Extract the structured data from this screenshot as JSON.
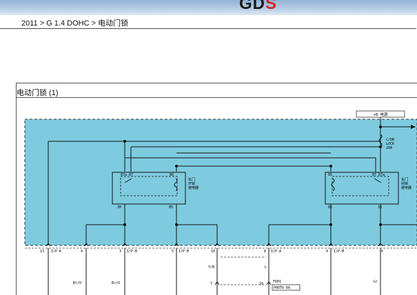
{
  "header": {
    "logo_main": "GD",
    "logo_accent": "S"
  },
  "breadcrumb": {
    "text": "2011 > G 1.4 DOHC > 电动门锁"
  },
  "document": {
    "title": "电动门锁 (1)"
  },
  "diagram": {
    "power_label": "+B 电源",
    "fuse_label": "C/DR\nLOCK\n20A",
    "relays": [
      {
        "name": "车门\n开锁\n继电器",
        "pins_top": [
          "87a",
          "87",
          "86"
        ],
        "pins_bottom": [
          "30",
          "85"
        ]
      },
      {
        "name": "车门\n闭锁\n继电器",
        "pins_top": [
          "85",
          "87",
          "87a"
        ],
        "pins_bottom": [
          "86",
          "30"
        ]
      }
    ],
    "connectors": [
      {
        "pin": "13",
        "label": "I/P-K"
      },
      {
        "pin": "4",
        "label": ""
      },
      {
        "pin": "3",
        "label": "I/P-B"
      },
      {
        "pin": "5",
        "label": "I/P-M"
      },
      {
        "pin": "10",
        "label": ""
      },
      {
        "pin": "8",
        "label": "I/P-A"
      },
      {
        "pin": "4",
        "label": "I/P-M"
      },
      {
        "pin": "6",
        "label": ""
      }
    ],
    "wire_colors": [
      "Br/O",
      "Br/O",
      "Y/B",
      "L",
      "Gr"
    ],
    "lower_pins": [
      "7",
      "16"
    ],
    "photo_ref": "FD01",
    "photo_label": "PHOTO 66"
  }
}
